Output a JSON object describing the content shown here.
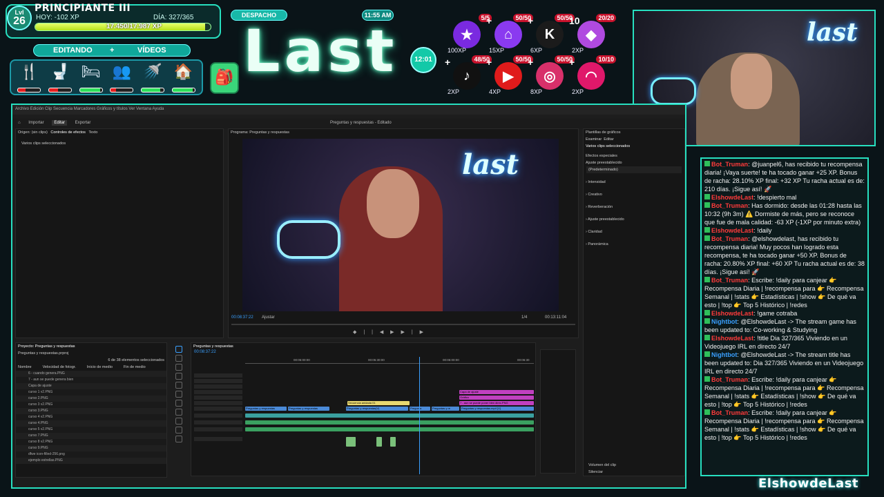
{
  "overlay": {
    "level_label": "Lvl",
    "level": "26",
    "rank": "PRINCIPIANTE III",
    "today": "HOY: -102 XP",
    "streak_day": "DÍA: 327/365",
    "xp_text": "17.450/17.987 XP",
    "xp_progress": 0.97,
    "mode_left": "EDITANDO",
    "mode_plus": "+",
    "mode_right": "VÍDEOS",
    "location": "DESPACHO",
    "clock": "11:55 AM",
    "title": "Last",
    "timer": "12:01",
    "needs": [
      {
        "icon": "fork-knife-icon",
        "glyph": "🍴",
        "color": "#e82020",
        "level": 0.35
      },
      {
        "icon": "toilet-icon",
        "glyph": "🚽",
        "color": "#e82020",
        "level": 0.4
      },
      {
        "icon": "bed-icon",
        "glyph": "🛏",
        "color": "#2ee05a",
        "level": 0.9
      },
      {
        "icon": "social-icon",
        "glyph": "👥",
        "color": "#e82020",
        "level": 0.25
      },
      {
        "icon": "shower-icon",
        "glyph": "🚿",
        "color": "#2ee05a",
        "level": 0.85
      },
      {
        "icon": "house-icon",
        "glyph": "🏠",
        "color": "#2ee05a",
        "level": 0.9
      }
    ],
    "socials": [
      {
        "name": "star-icon",
        "glyph": "★",
        "bg": "#7a2ae0",
        "count": "5/5",
        "xp": "100XP",
        "plus": ""
      },
      {
        "name": "twitch-icon",
        "glyph": "⌂",
        "bg": "#8a3af0",
        "count": "50/50",
        "xp": "15XP",
        "plus": "+"
      },
      {
        "name": "kick-icon",
        "glyph": "K",
        "bg": "#1b1b1b",
        "count": "50/50",
        "xp": "6XP",
        "plus": "+"
      },
      {
        "name": "crystal-icon",
        "glyph": "◆",
        "bg": "#b04ae0",
        "count": "20/20",
        "xp": "2XP",
        "plus": "10"
      },
      {
        "name": "tiktok-icon",
        "glyph": "♪",
        "bg": "#111",
        "count": "48/50",
        "xp": "2XP",
        "plus": "+"
      },
      {
        "name": "youtube-icon",
        "glyph": "▶",
        "bg": "#e01b1b",
        "count": "50/50",
        "xp": "4XP",
        "plus": "+"
      },
      {
        "name": "instagram-icon",
        "glyph": "◎",
        "bg": "#d8306a",
        "count": "50/50",
        "xp": "8XP",
        "plus": "+"
      },
      {
        "name": "cap-icon",
        "glyph": "◠",
        "bg": "#e0186a",
        "count": "10/10",
        "xp": "2XP",
        "plus": "+"
      }
    ],
    "signature": "ElshowdeLast",
    "cam_text": "last"
  },
  "chat": {
    "messages": [
      {
        "user": "Bot_Truman",
        "cls": "bot",
        "text": ": @juanpel6, has recibido tu recompensa diaria! ¡Vaya suerte! te ha tocado ganar +25 XP. Bonus de racha: 28.10% XP final: +32 XP Tu racha actual es de: 210 días. ¡Sigue así! 🚀"
      },
      {
        "user": "ElshowdeLast",
        "cls": "own",
        "text": ": !despierto mal"
      },
      {
        "user": "Bot_Truman",
        "cls": "bot",
        "text": ": Has dormido: desde las 01:28 hasta las 10:32 (9h 3m) ⚠️ Dormiste de más, pero se reconoce que fue de mala calidad: -63 XP (-1XP por minuto extra)"
      },
      {
        "user": "ElshowdeLast",
        "cls": "own",
        "text": ": !daily"
      },
      {
        "user": "Bot_Truman",
        "cls": "bot",
        "text": ": @elshowdelast, has recibido tu recompensa diaria! Muy pocos han logrado esta recompensa, te ha tocado ganar +50 XP. Bonus de racha: 20.80% XP final: +60 XP Tu racha actual es de: 38 días. ¡Sigue así! 🚀"
      },
      {
        "user": "Bot_Truman",
        "cls": "bot",
        "text": ": Escribe: !daily para canjear 👉 Recompensa Diaria | !recompensa para 👉 Recompensa Semanal | !stats 👉 Estadísticas | !show 👉 De qué va esto | !top 👉 Top 5 Histórico | !redes"
      },
      {
        "user": "ElshowdeLast",
        "cls": "own",
        "text": ": !game cotraba"
      },
      {
        "user": "Nightbot",
        "cls": "night",
        "text": ": @ElshowdeLast -> The stream game has been updated to: Co-working & Studying"
      },
      {
        "user": "ElshowdeLast",
        "cls": "own",
        "text": ": !title Dia 327/365 Viviendo en un Videojuego IRL en directo 24/7"
      },
      {
        "user": "Nightbot",
        "cls": "night",
        "text": ": @ElshowdeLast -> The stream title has been updated to: Dia 327/365 Viviendo en un Videojuego IRL en directo 24/7"
      },
      {
        "user": "Bot_Truman",
        "cls": "bot",
        "text": ": Escribe: !daily para canjear 👉 Recompensa Diaria | !recompensa para 👉 Recompensa Semanal | !stats 👉 Estadísticas | !show 👉 De qué va esto | !top 👉 Top 5 Histórico | !redes"
      },
      {
        "user": "Bot_Truman",
        "cls": "bot",
        "text": ": Escribe: !daily para canjear 👉 Recompensa Diaria | !recompensa para 👉 Recompensa Semanal | !stats 👉 Estadísticas | !show 👉 De qué va esto | !top 👉 Top 5 Histórico | !redes"
      }
    ]
  },
  "premiere": {
    "menu": "Archivo  Edición  Clip  Secuencia  Marcadores  Gráficos y títulos  Ver  Ventana  Ayuda",
    "tabs": [
      "Inicio",
      "Importar",
      "Editar",
      "Exportar"
    ],
    "active_tab": "Editar",
    "window_title": "Preguntas y respuestas - Editado",
    "source_panel": "Origen: (sin clips)",
    "effects_tab": "Controles de efectos",
    "text_tab": "Texto",
    "no_clips": "Varios clips seleccionados",
    "program_title": "Programa: Preguntas y respuestas",
    "timecode_in": "00:08:37:22",
    "fit": "Ajustar",
    "scale": "1/4",
    "timecode_out": "00:13:11:04",
    "sequence_tab": "Preguntas y respuestas",
    "seq_time": "00:08:37:22",
    "ruler": [
      "00:05:00:00",
      "00:05:30:00",
      "00:06:00:00",
      "00:06:30"
    ],
    "project_title": "Proyecto: Preguntas y respuestas",
    "project_file": "Preguntas y respuestas.prproj",
    "project_count": "6 de 38 elementos seleccionados",
    "project_cols": [
      "Nombre",
      "Velocidad de fotogr.",
      "Inicio de medio",
      "Fin de medio"
    ],
    "project_items": [
      "6 - cuando genera.PNG",
      "7 - aun se puede genera bien",
      "Capa de ajuste",
      "curso 1 v2.PNG",
      "curso 2.PNG",
      "curso 3 v2.PNG",
      "curso 3.PNG",
      "curso 4 v2.PNG",
      "curso 4.PNG",
      "curso 5 v2.PNG",
      "curso 7.PNG",
      "curso 8 v2.PNG",
      "curso 9.PNG",
      "dfwe icon-filled-256.png",
      "ejemplo estrellas.PNG"
    ],
    "essential_title": "Plantillas de gráficos",
    "essential_tabs": [
      "Examinar",
      "Editar"
    ],
    "essential_sel": "Varios clips seleccionados",
    "effects_label": "Efectos especiales",
    "preset_label": "Ajuste preestablecido",
    "preset_value": "(Predeterminado)",
    "sections": [
      "Intensidad",
      "Creativo",
      "Reverberación",
      "Ajuste preestablecido",
      "Claridad",
      "Panorámica"
    ],
    "clip_volume": "Volumen del clip",
    "silence": "Silenciar",
    "clips_v": [
      "Preguntas y respuestas",
      "Preguntas y respuestas",
      "Preguntas y respuestas(V)",
      "Pregunta",
      "Preguntas y re",
      "Preguntas y respuestas.mp4 [V]"
    ],
    "clip_seq": "Secuencia anidada 01",
    "clips_graphic": [
      "Capa de ajuste",
      "Gráfico",
      "7 - aun se puede poner bien direc.PNG"
    ]
  }
}
